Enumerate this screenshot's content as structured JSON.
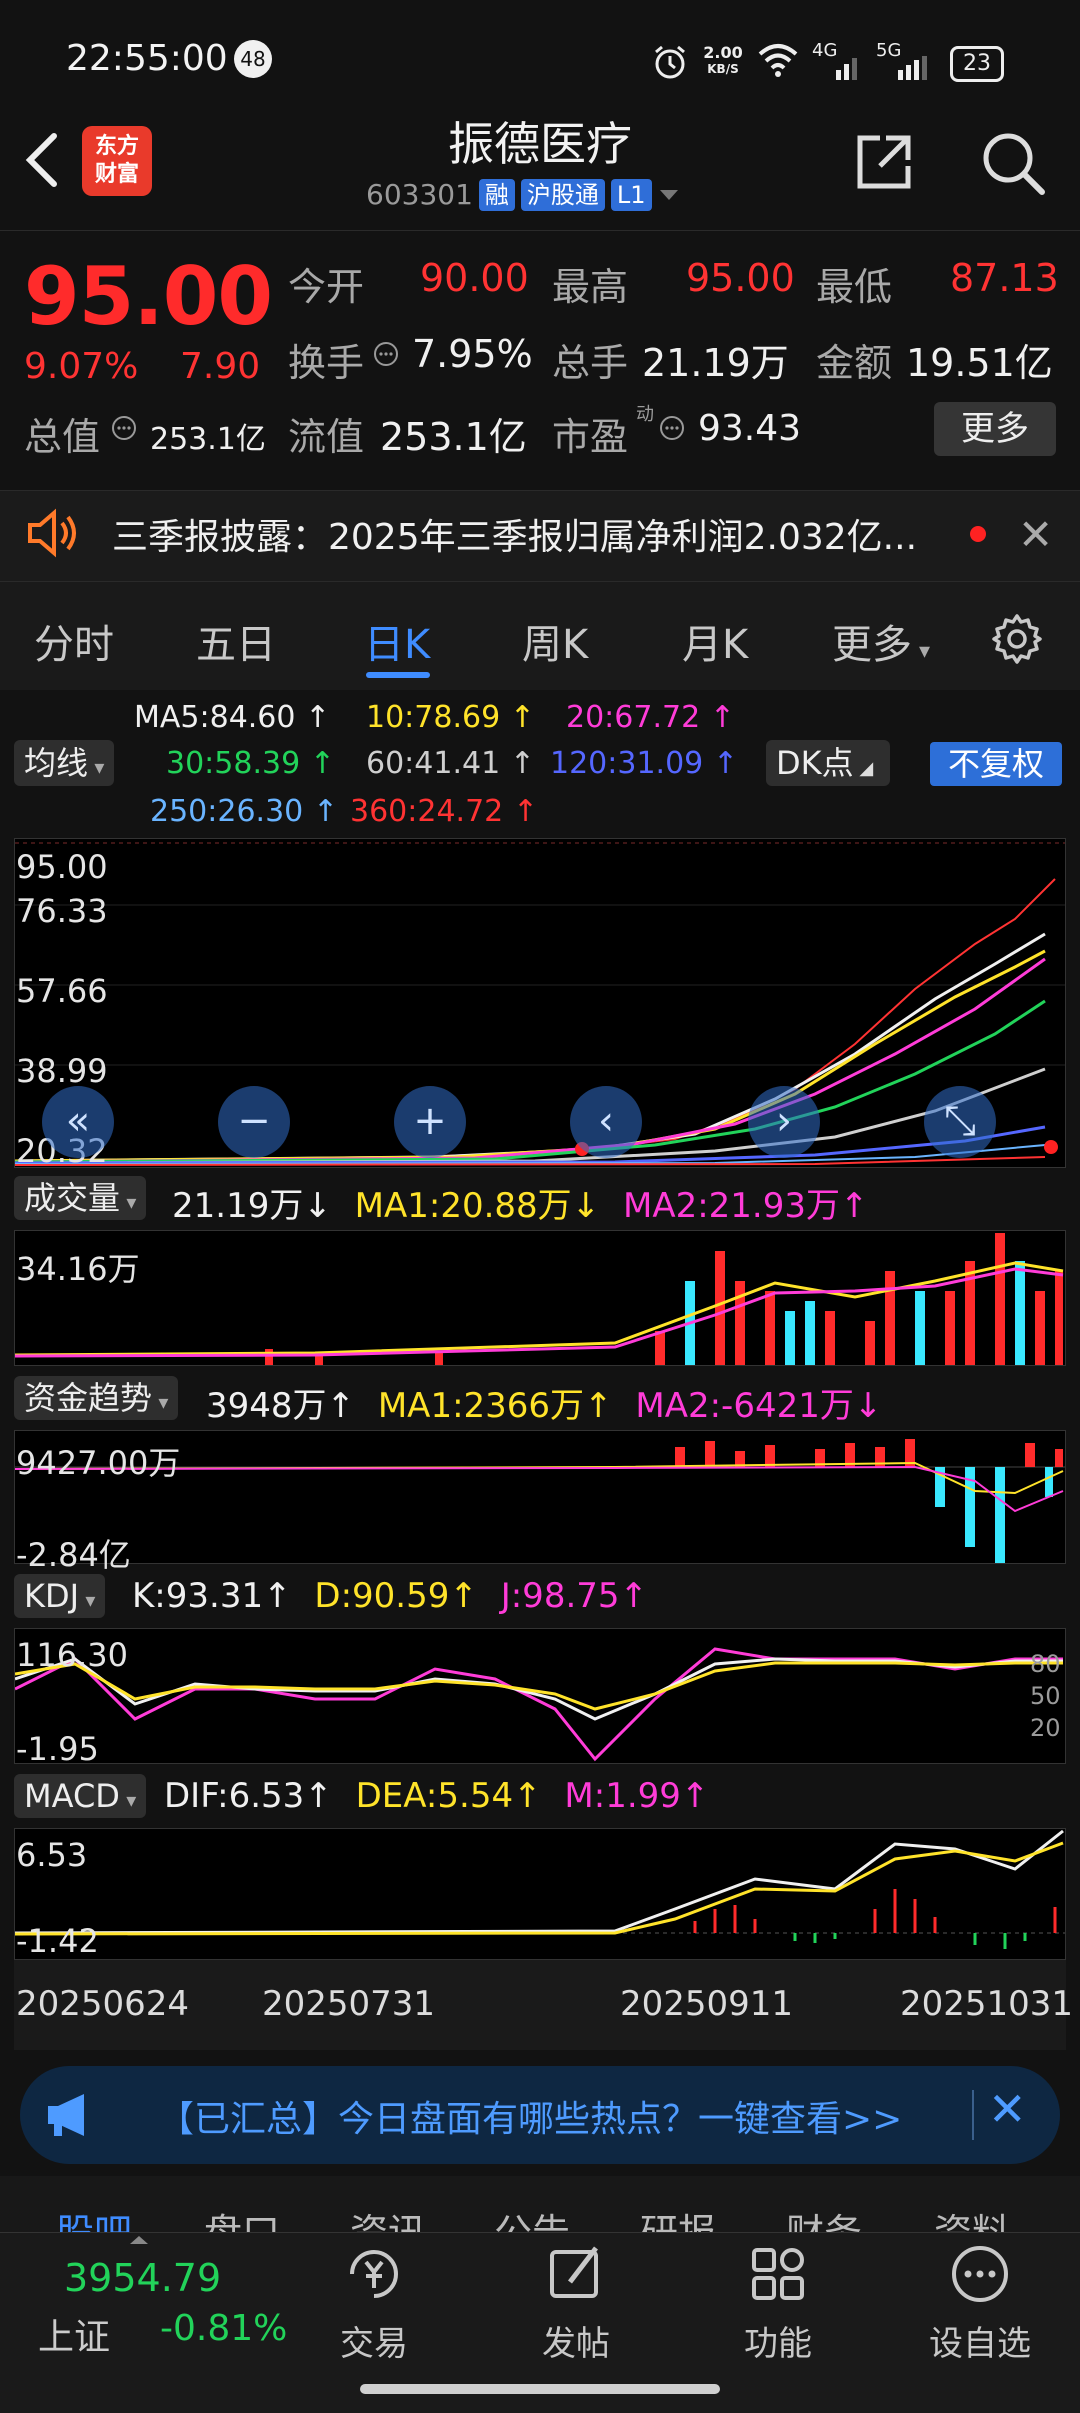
{
  "status": {
    "time": "22:55:00",
    "notif": "48",
    "net_speed": "2.00",
    "net_unit": "KB/S",
    "sig1": "4G",
    "sig2": "5G",
    "battery": "23"
  },
  "header": {
    "logo_line1": "东方",
    "logo_line2": "财富",
    "name": "振德医疗",
    "code": "603301",
    "tags": [
      "融",
      "沪股通",
      "L1"
    ]
  },
  "quote": {
    "price": "95.00",
    "pct": "9.07%",
    "chg": "7.90",
    "fields": [
      {
        "label": "今开",
        "value": "90.00",
        "color": "red"
      },
      {
        "label": "最高",
        "value": "95.00",
        "color": "red"
      },
      {
        "label": "最低",
        "value": "87.13",
        "color": "red"
      },
      {
        "label": "换手",
        "value": "7.95%",
        "color": "white"
      },
      {
        "label": "总手",
        "value": "21.19万",
        "color": "white"
      },
      {
        "label": "金额",
        "value": "19.51亿",
        "color": "white"
      },
      {
        "label": "总值",
        "value": "253.1亿",
        "color": "white"
      },
      {
        "label": "流值",
        "value": "253.1亿",
        "color": "white"
      },
      {
        "label": "市盈",
        "value": "93.43",
        "color": "white"
      }
    ],
    "pe_sup": "动",
    "more": "更多"
  },
  "news": {
    "text": "三季报披露：2025年三季报归属净利润2.032亿..."
  },
  "tabs": [
    "分时",
    "五日",
    "日K",
    "周K",
    "月K",
    "更多"
  ],
  "ma_legend": {
    "chip": "均线",
    "dk": "DK点",
    "fq": "不复权",
    "items": [
      {
        "text": "MA5:84.60",
        "arrow": "↑",
        "color": "#f0f0f0"
      },
      {
        "text": "10:78.69",
        "arrow": "↑",
        "color": "#ffe32a"
      },
      {
        "text": "20:67.72",
        "arrow": "↑",
        "color": "#ff3cd8"
      },
      {
        "text": "30:58.39",
        "arrow": "↑",
        "color": "#22d35a"
      },
      {
        "text": "60:41.41",
        "arrow": "↑",
        "color": "#cfcfcf"
      },
      {
        "text": "120:31.09",
        "arrow": "↑",
        "color": "#5567ff"
      },
      {
        "text": "250:26.30",
        "arrow": "↑",
        "color": "#6ab4ff"
      },
      {
        "text": "360:24.72",
        "arrow": "↑",
        "color": "#ff3333"
      }
    ]
  },
  "kline": {
    "y_labels": [
      "95.00",
      "76.33",
      "57.66",
      "38.99",
      "20.32"
    ]
  },
  "volume": {
    "chip": "成交量",
    "value": "21.19万",
    "value_arrow": "↓",
    "ma1": "MA1:20.88万",
    "ma1_arrow": "↓",
    "ma2": "MA2:21.93万",
    "ma2_arrow": "↑",
    "top": "34.16万"
  },
  "fund": {
    "chip": "资金趋势",
    "value": "3948万",
    "value_arrow": "↑",
    "ma1": "MA1:2366万",
    "ma1_arrow": "↑",
    "ma2": "MA2:-6421万",
    "ma2_arrow": "↓",
    "top": "9427.00万",
    "bottom": "-2.84亿"
  },
  "kdj": {
    "chip": "KDJ",
    "k": "K:93.31",
    "k_arrow": "↑",
    "d": "D:90.59",
    "d_arrow": "↑",
    "j": "J:98.75",
    "j_arrow": "↑",
    "top": "116.30",
    "bottom": "-1.95",
    "r1": "80",
    "r2": "50",
    "r3": "20"
  },
  "macd": {
    "chip": "MACD",
    "dif": "DIF:6.53",
    "dif_arrow": "↑",
    "dea": "DEA:5.54",
    "dea_arrow": "↑",
    "m": "M:1.99",
    "m_arrow": "↑",
    "top": "6.53",
    "bottom": "-1.42"
  },
  "dates": [
    "20250624",
    "20250731",
    "20250911",
    "20251031"
  ],
  "banner": {
    "text": "【已汇总】今日盘面有哪些热点？一键查看>>"
  },
  "bottom_tabs": [
    "股吧",
    "盘口",
    "资讯",
    "公告",
    "研报",
    "财务",
    "资料"
  ],
  "index": {
    "value": "3954.79",
    "name": "上证",
    "pct": "-0.81%"
  },
  "nav": [
    "交易",
    "发帖",
    "功能",
    "设自选"
  ]
}
